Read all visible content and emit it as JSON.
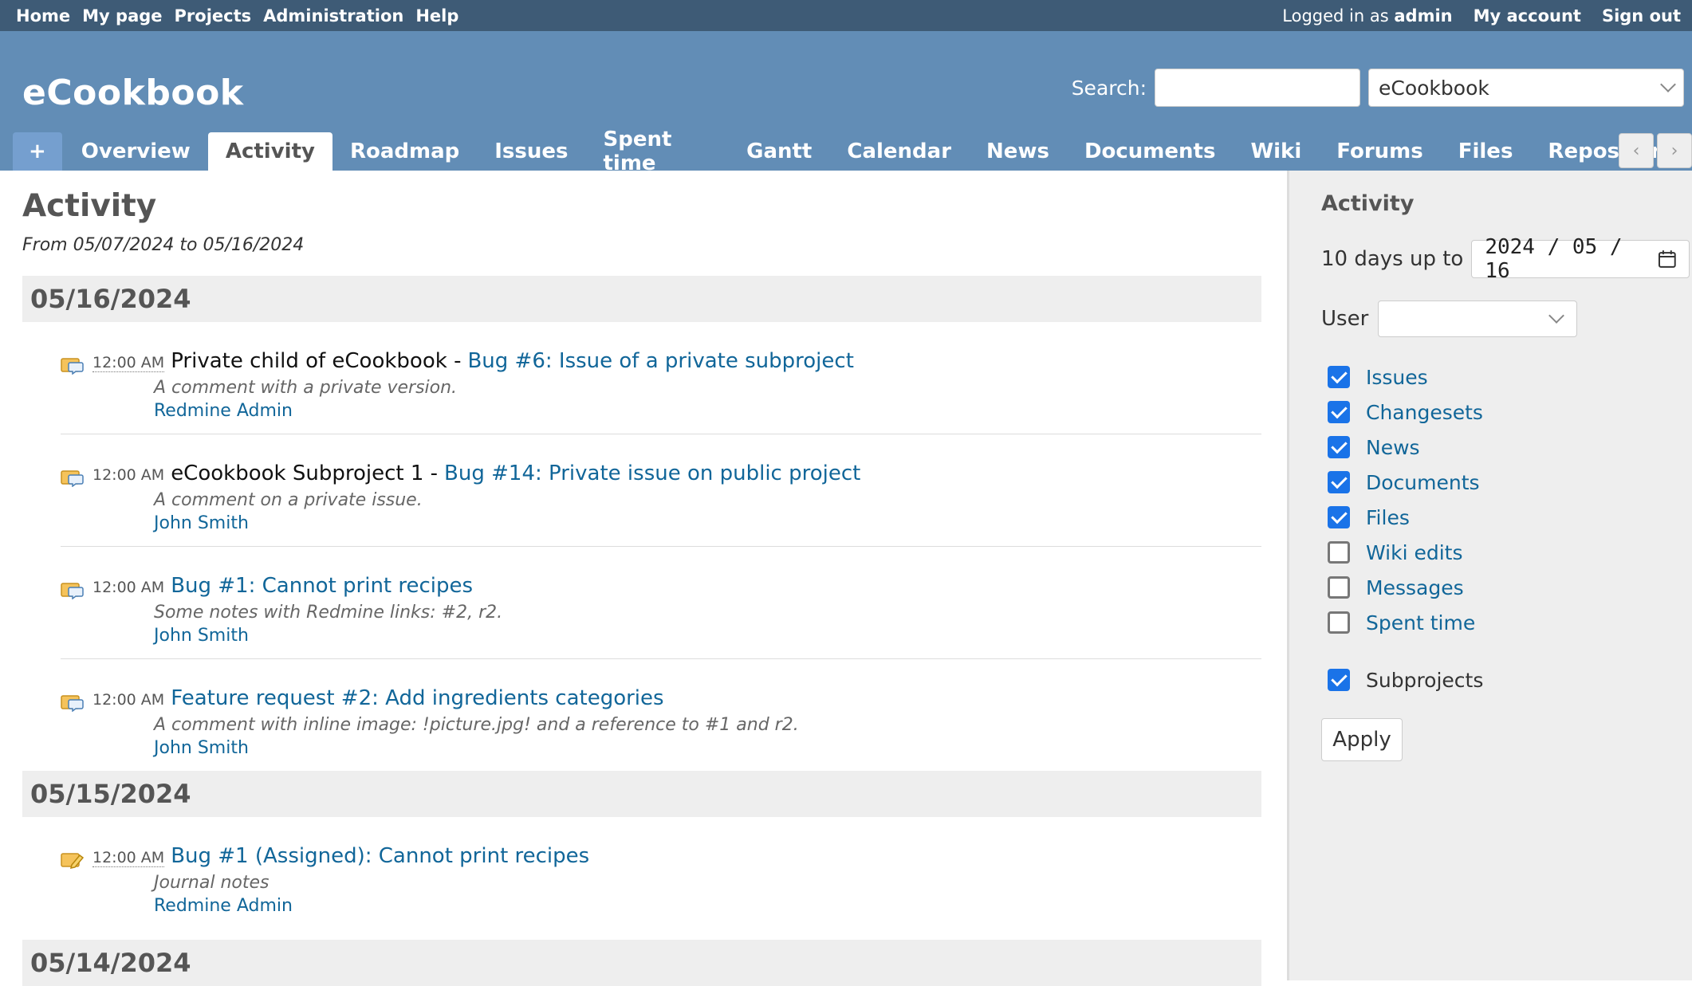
{
  "top_menu": {
    "links": [
      "Home",
      "My page",
      "Projects",
      "Administration",
      "Help"
    ],
    "logged_in_prefix": "Logged in as",
    "user": "admin",
    "my_account": "My account",
    "sign_out": "Sign out"
  },
  "header": {
    "title": "eCookbook",
    "search_label": "Search:",
    "search_value": "",
    "project_select": "eCookbook"
  },
  "tabs": [
    {
      "label": "+"
    },
    {
      "label": "Overview"
    },
    {
      "label": "Activity"
    },
    {
      "label": "Roadmap"
    },
    {
      "label": "Issues"
    },
    {
      "label": "Spent time"
    },
    {
      "label": "Gantt"
    },
    {
      "label": "Calendar"
    },
    {
      "label": "News"
    },
    {
      "label": "Documents"
    },
    {
      "label": "Wiki"
    },
    {
      "label": "Forums"
    },
    {
      "label": "Files"
    },
    {
      "label": "Repository"
    }
  ],
  "selected_tab": "Activity",
  "content": {
    "title": "Activity",
    "subtitle": "From 05/07/2024 to 05/16/2024",
    "days": [
      {
        "date": "05/16/2024",
        "events": [
          {
            "time": "12:00 AM",
            "project": "Private child of eCookbook -",
            "link": "Bug #6: Issue of a private subproject",
            "desc": "A comment with a private version.",
            "author": "Redmine Admin"
          },
          {
            "time": "12:00 AM",
            "project": "eCookbook Subproject 1 -",
            "link": "Bug #14: Private issue on public project",
            "desc": "A comment on a private issue.",
            "author": "John Smith"
          },
          {
            "time": "12:00 AM",
            "project": "",
            "link": "Bug #1: Cannot print recipes",
            "desc": "Some notes with Redmine links: #2, r2.",
            "author": "John Smith"
          },
          {
            "time": "12:00 AM",
            "project": "",
            "link": "Feature request #2: Add ingredients categories",
            "desc": "A comment with inline image: !picture.jpg! and a reference to #1 and r2.",
            "author": "John Smith"
          }
        ]
      },
      {
        "date": "05/15/2024",
        "events": [
          {
            "time": "12:00 AM",
            "project": "",
            "link": "Bug #1 (Assigned): Cannot print recipes",
            "desc": "Journal notes",
            "author": "Redmine Admin"
          }
        ]
      },
      {
        "date": "05/14/2024",
        "events": []
      }
    ]
  },
  "sidebar": {
    "title": "Activity",
    "days_label": "10 days up to",
    "date_value": "2024 / 05 / 16",
    "user_label": "User",
    "user_value": "",
    "filters": [
      {
        "label": "Issues",
        "checked": true
      },
      {
        "label": "Changesets",
        "checked": true
      },
      {
        "label": "News",
        "checked": true
      },
      {
        "label": "Documents",
        "checked": true
      },
      {
        "label": "Files",
        "checked": true
      },
      {
        "label": "Wiki edits",
        "checked": false
      },
      {
        "label": "Messages",
        "checked": false
      },
      {
        "label": "Spent time",
        "checked": false
      }
    ],
    "subprojects": {
      "label": "Subprojects",
      "checked": true
    },
    "apply_label": "Apply"
  },
  "colors": {
    "top_menu_bg": "#3e5b76",
    "header_bg": "#628db6",
    "link": "#116699",
    "checkbox": "#1a73e8"
  }
}
